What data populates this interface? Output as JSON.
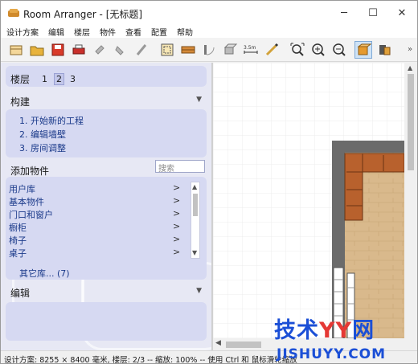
{
  "window": {
    "title": "Room Arranger - [无标题]",
    "icon": "sofa-icon",
    "controls": {
      "minimize": "─",
      "maximize": "☐",
      "close": "✕"
    }
  },
  "menu": [
    "设计方案",
    "编辑",
    "楼层",
    "物件",
    "查看",
    "配置",
    "帮助"
  ],
  "toolbar": {
    "buttons": [
      "new-icon",
      "open-icon",
      "save-icon",
      "print-icon",
      "undo-icon",
      "redo-icon",
      "paint-icon",
      "floorplan-icon",
      "wall-icon",
      "door-icon",
      "3d-icon",
      "measure-icon",
      "pencil-icon",
      "zoom-fit-icon",
      "zoom-in-icon",
      "zoom-out-icon",
      "box-icon",
      "library-icon"
    ],
    "measure_label": "3.5m",
    "more": "»"
  },
  "floors": {
    "label": "楼层",
    "items": [
      "1",
      "2",
      "3"
    ],
    "active": "2"
  },
  "build": {
    "label": "构建",
    "collapse": "▼",
    "steps": [
      "1. 开始新的工程",
      "2. 编辑墙壁",
      "3. 房间调整"
    ]
  },
  "add_objects": {
    "label": "添加物件",
    "search_placeholder": "搜索",
    "libraries": [
      "用户库",
      "基本物件",
      "门口和窗户",
      "橱柜",
      "椅子",
      "桌子"
    ],
    "item_arrow": ">",
    "more_libs": "其它库... (7)"
  },
  "edit": {
    "label": "编辑",
    "collapse": "▼"
  },
  "statusbar": {
    "text": "设计方案: 8255 × 8400 毫米, 楼层: 2/3 -- 缩放: 100% -- 使用 Ctrl 和 鼠标滑轮缩放"
  },
  "watermark": {
    "main_a": "技术",
    "main_yy": "YY",
    "main_b": "网",
    "sub": "JISHUYY.COM"
  },
  "colors": {
    "wall": "#6b6b6b",
    "sofa": "#b8612d",
    "floor": "#d9b98c",
    "panel": "#e7e8f4",
    "accent": "#1b3a8a"
  }
}
